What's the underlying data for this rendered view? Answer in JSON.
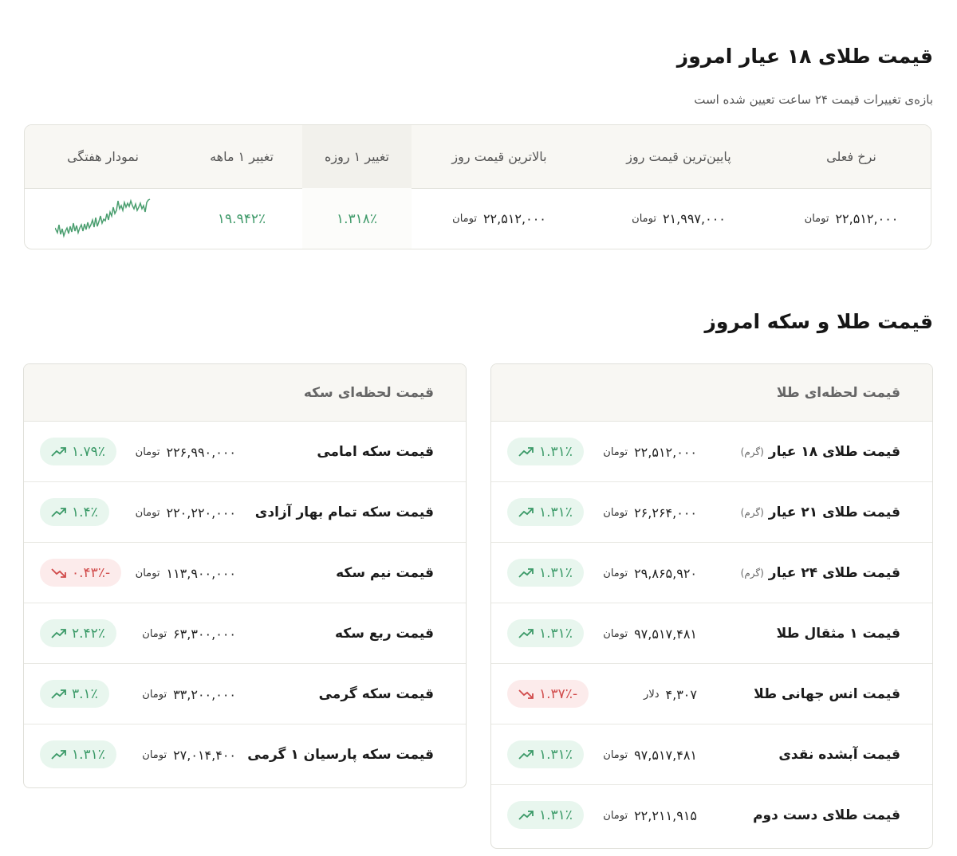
{
  "section1": {
    "title": "قیمت طلای ۱۸ عیار امروز",
    "subtitle": "بازه‌ی تغییرات قیمت ۲۴ ساعت تعیین شده است",
    "headers": {
      "current": "نرخ فعلی",
      "low": "پایین‌ترین قیمت روز",
      "high": "بالاترین قیمت روز",
      "day": "تغییر ۱ روزه",
      "month": "تغییر ۱ ماهه",
      "weekly": "نمودار هفتگی"
    },
    "values": {
      "current": "۲۲,۵۱۲,۰۰۰",
      "low": "۲۱,۹۹۷,۰۰۰",
      "high": "۲۲,۵۱۲,۰۰۰",
      "day": "۱.۳۱۸٪",
      "month": "۱۹.۹۴۲٪",
      "unit": "تومان"
    },
    "sparkline_color": "#4a9e6f"
  },
  "section2": {
    "title": "قیمت طلا و سکه امروز",
    "gold": {
      "header": "قیمت لحظه‌ای طلا",
      "rows": [
        {
          "name": "قیمت طلای ۱۸ عیار",
          "note": "(گرم)",
          "price": "۲۲,۵۱۲,۰۰۰",
          "unit": "تومان",
          "change": "۱.۳۱٪",
          "dir": "up"
        },
        {
          "name": "قیمت طلای ۲۱ عیار",
          "note": "(گرم)",
          "price": "۲۶,۲۶۴,۰۰۰",
          "unit": "تومان",
          "change": "۱.۳۱٪",
          "dir": "up"
        },
        {
          "name": "قیمت طلای ۲۴ عیار",
          "note": "(گرم)",
          "price": "۲۹,۸۶۵,۹۲۰",
          "unit": "تومان",
          "change": "۱.۳۱٪",
          "dir": "up"
        },
        {
          "name": "قیمت ۱ مثقال طلا",
          "note": "",
          "price": "۹۷,۵۱۷,۴۸۱",
          "unit": "تومان",
          "change": "۱.۳۱٪",
          "dir": "up"
        },
        {
          "name": "قیمت انس جهانی طلا",
          "note": "",
          "price": "۴,۳۰۷",
          "unit": "دلار",
          "change": "-۱.۳۷٪",
          "dir": "down"
        },
        {
          "name": "قیمت آبشده نقدی",
          "note": "",
          "price": "۹۷,۵۱۷,۴۸۱",
          "unit": "تومان",
          "change": "۱.۳۱٪",
          "dir": "up"
        },
        {
          "name": "قیمت طلای دست دوم",
          "note": "",
          "price": "۲۲,۲۱۱,۹۱۵",
          "unit": "تومان",
          "change": "۱.۳۱٪",
          "dir": "up"
        }
      ]
    },
    "coin": {
      "header": "قیمت لحظه‌ای سکه",
      "rows": [
        {
          "name": "قیمت سکه امامی",
          "price": "۲۲۶,۹۹۰,۰۰۰",
          "unit": "تومان",
          "change": "۱.۷۹٪",
          "dir": "up"
        },
        {
          "name": "قیمت سکه تمام بهار آزادی",
          "price": "۲۲۰,۲۲۰,۰۰۰",
          "unit": "تومان",
          "change": "۱.۴٪",
          "dir": "up"
        },
        {
          "name": "قیمت نیم سکه",
          "price": "۱۱۳,۹۰۰,۰۰۰",
          "unit": "تومان",
          "change": "-۰.۴۳٪",
          "dir": "down"
        },
        {
          "name": "قیمت ربع سکه",
          "price": "۶۳,۳۰۰,۰۰۰",
          "unit": "تومان",
          "change": "۲.۴۲٪",
          "dir": "up"
        },
        {
          "name": "قیمت سکه گرمی",
          "price": "۳۳,۲۰۰,۰۰۰",
          "unit": "تومان",
          "change": "۳.۱٪",
          "dir": "up"
        },
        {
          "name": "قیمت سکه پارسیان ۱ گرمی",
          "price": "۲۷,۰۱۴,۴۰۰",
          "unit": "تومان",
          "change": "۱.۳۱٪",
          "dir": "up"
        }
      ]
    }
  }
}
